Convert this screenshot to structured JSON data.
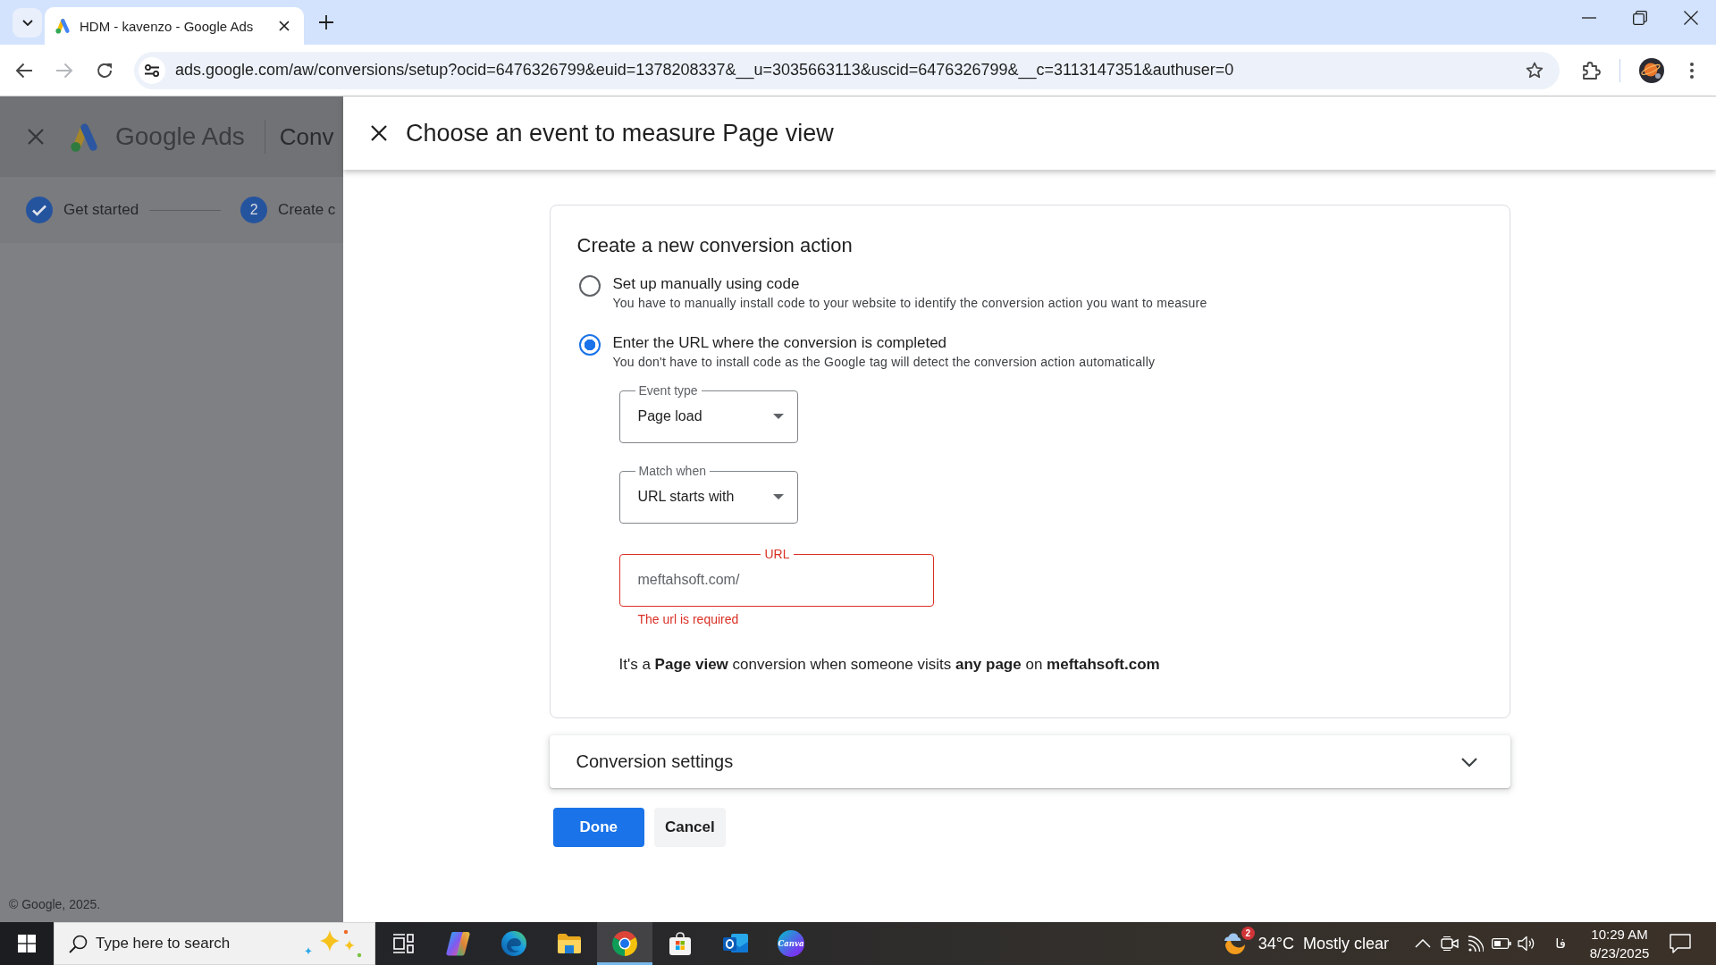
{
  "browser": {
    "tab": {
      "title": "HDM - kavenzo - Google Ads"
    },
    "forward_disabled": true,
    "url": "ads.google.com/aw/conversions/setup?ocid=6476326799&euid=1378208337&__u=3035663113&uscid=6476326799&__c=3113147351&authuser=0"
  },
  "background_page": {
    "product_name": "Google Ads",
    "page_title": "Conv",
    "steps": [
      {
        "label": "Get started",
        "done": true
      },
      {
        "number": "2",
        "label": "Create c",
        "done": false
      }
    ],
    "footer": "© Google, 2025."
  },
  "dialog": {
    "title": "Choose an event to measure Page view",
    "card": {
      "heading": "Create a new conversion action",
      "options": [
        {
          "label": "Set up manually using code",
          "description": "You have to manually install code to your website to identify the conversion action you want to measure",
          "selected": false
        },
        {
          "label": "Enter the URL where the conversion is completed",
          "description": "You don't have to install code as the Google tag will detect the conversion action automatically",
          "selected": true
        }
      ],
      "fields": [
        {
          "kind": "select",
          "label": "Event type",
          "value": "Page load"
        },
        {
          "kind": "select",
          "label": "Match when",
          "value": "URL starts with"
        },
        {
          "kind": "text",
          "label": "URL",
          "placeholder": "meftahsoft.com/",
          "error": "The url is required"
        }
      ],
      "summary": "It's a **Page view** conversion when someone visits **any page** on **meftahsoft.com**"
    },
    "settings_panel": {
      "title": "Conversion settings",
      "expanded": false
    },
    "buttons": [
      {
        "label": "Done",
        "kind": "primary"
      },
      {
        "label": "Cancel",
        "kind": "secondary"
      }
    ]
  },
  "taskbar": {
    "search": {
      "placeholder": "Type here to search"
    },
    "apps": [
      {
        "kind": "taskview",
        "selected": false
      },
      {
        "kind": "copilot",
        "selected": false
      },
      {
        "kind": "edge",
        "selected": false
      },
      {
        "kind": "files",
        "selected": false
      },
      {
        "kind": "chrome",
        "selected": true
      },
      {
        "kind": "store",
        "selected": false
      },
      {
        "kind": "outlook",
        "selected": false
      },
      {
        "kind": "canva",
        "label": "Canva",
        "selected": false
      }
    ],
    "weather": {
      "badge": "2",
      "temperature": "34°C",
      "condition": "Mostly clear"
    },
    "language": "فا",
    "time": "10:29 AM",
    "date": "8/23/2025"
  }
}
